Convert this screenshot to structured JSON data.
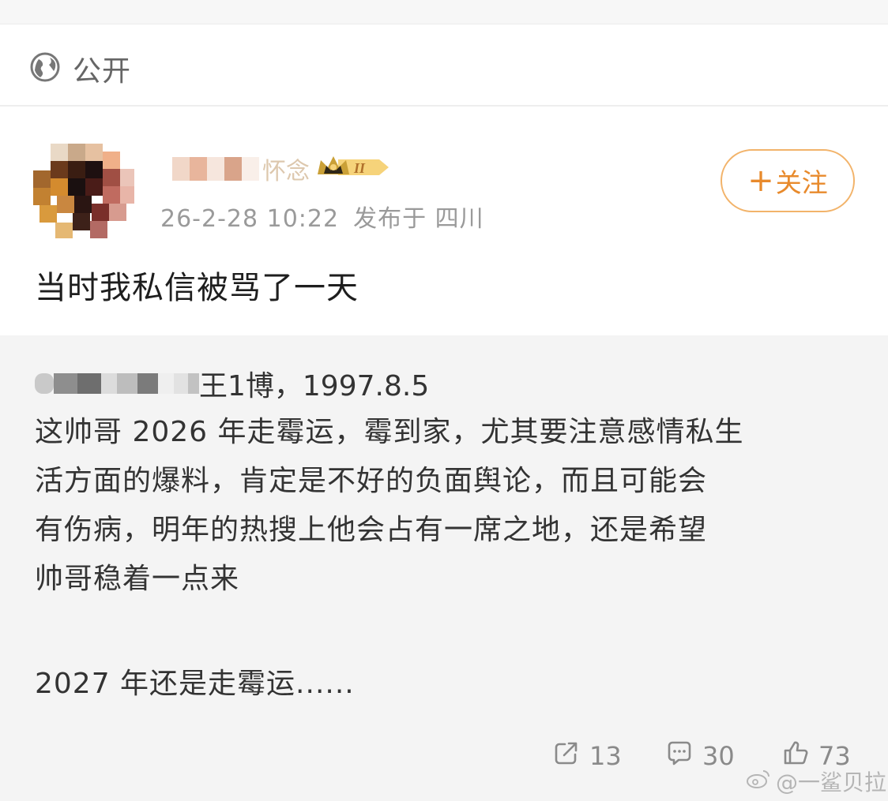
{
  "header": {
    "privacy_label": "公开",
    "privacy_icon": "globe-icon"
  },
  "post": {
    "author_name_visible": "怀念",
    "timestamp": "26-2-28 10:22",
    "location": "发布于 四川",
    "follow_label": "关注",
    "text": "当时我私信被骂了一天"
  },
  "quoted": {
    "first_line": "王1博，1997.8.5",
    "body_lines": [
      "这帅哥 2026 年走霉运，霉到家，尤其要注意感情私生",
      "活方面的爆料，肯定是不好的负面舆论，而且可能会",
      "有伤病，明年的热搜上他会占有一席之地，还是希望",
      "帅哥稳着一点来"
    ],
    "extra_line": "2027 年还是走霉运......"
  },
  "actions": {
    "reposts": "13",
    "comments": "30",
    "likes": "73"
  },
  "watermark": "@一鲨贝拉",
  "colors": {
    "accent": "#e88a2c",
    "follow_border": "#f2b36a",
    "quote_bg": "#f4f4f4"
  }
}
